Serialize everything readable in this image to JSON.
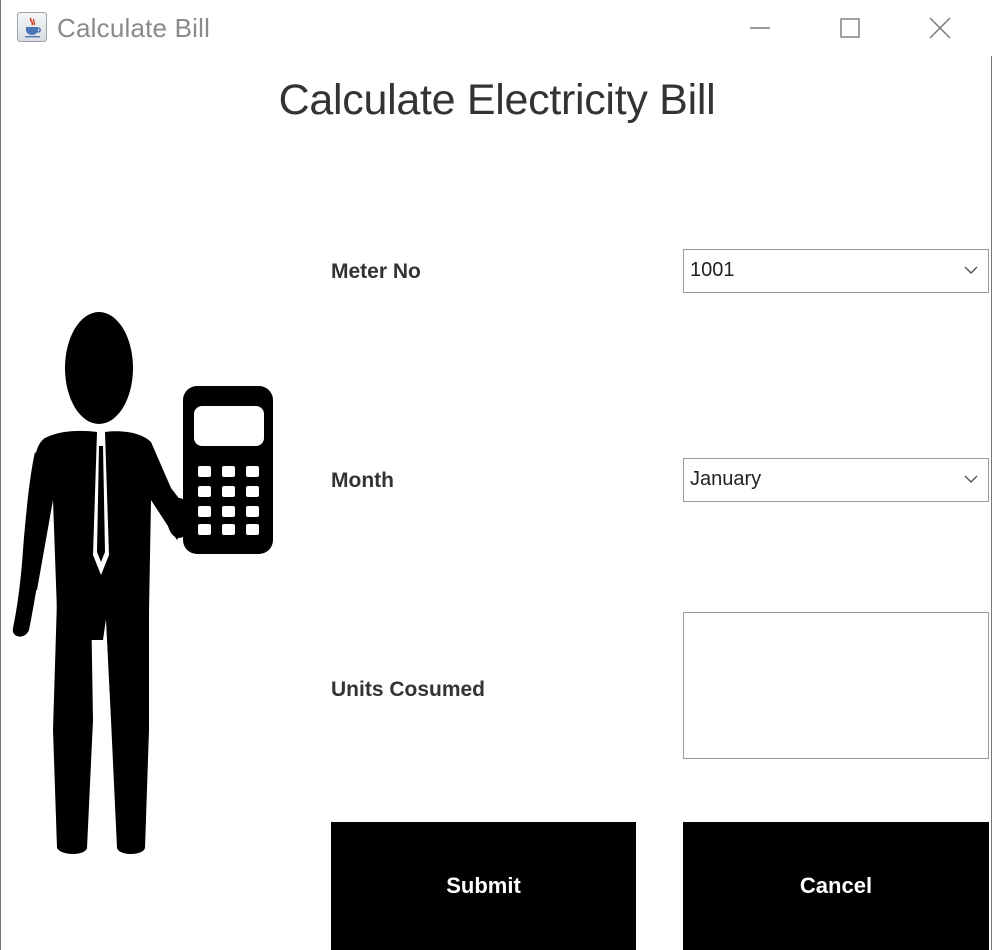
{
  "window": {
    "title": "Calculate Bill",
    "icon": "java-cup-icon"
  },
  "heading": "Calculate Electricity Bill",
  "form": {
    "meter_label": "Meter No",
    "meter_value": "1001",
    "month_label": "Month",
    "month_value": "January",
    "units_label": "Units Cosumed",
    "units_value": ""
  },
  "buttons": {
    "submit": "Submit",
    "cancel": "Cancel"
  },
  "colors": {
    "button_bg": "#000000",
    "button_text": "#ffffff",
    "window_bg": "#ffffff"
  },
  "illustration": "man-with-calculator-icon"
}
